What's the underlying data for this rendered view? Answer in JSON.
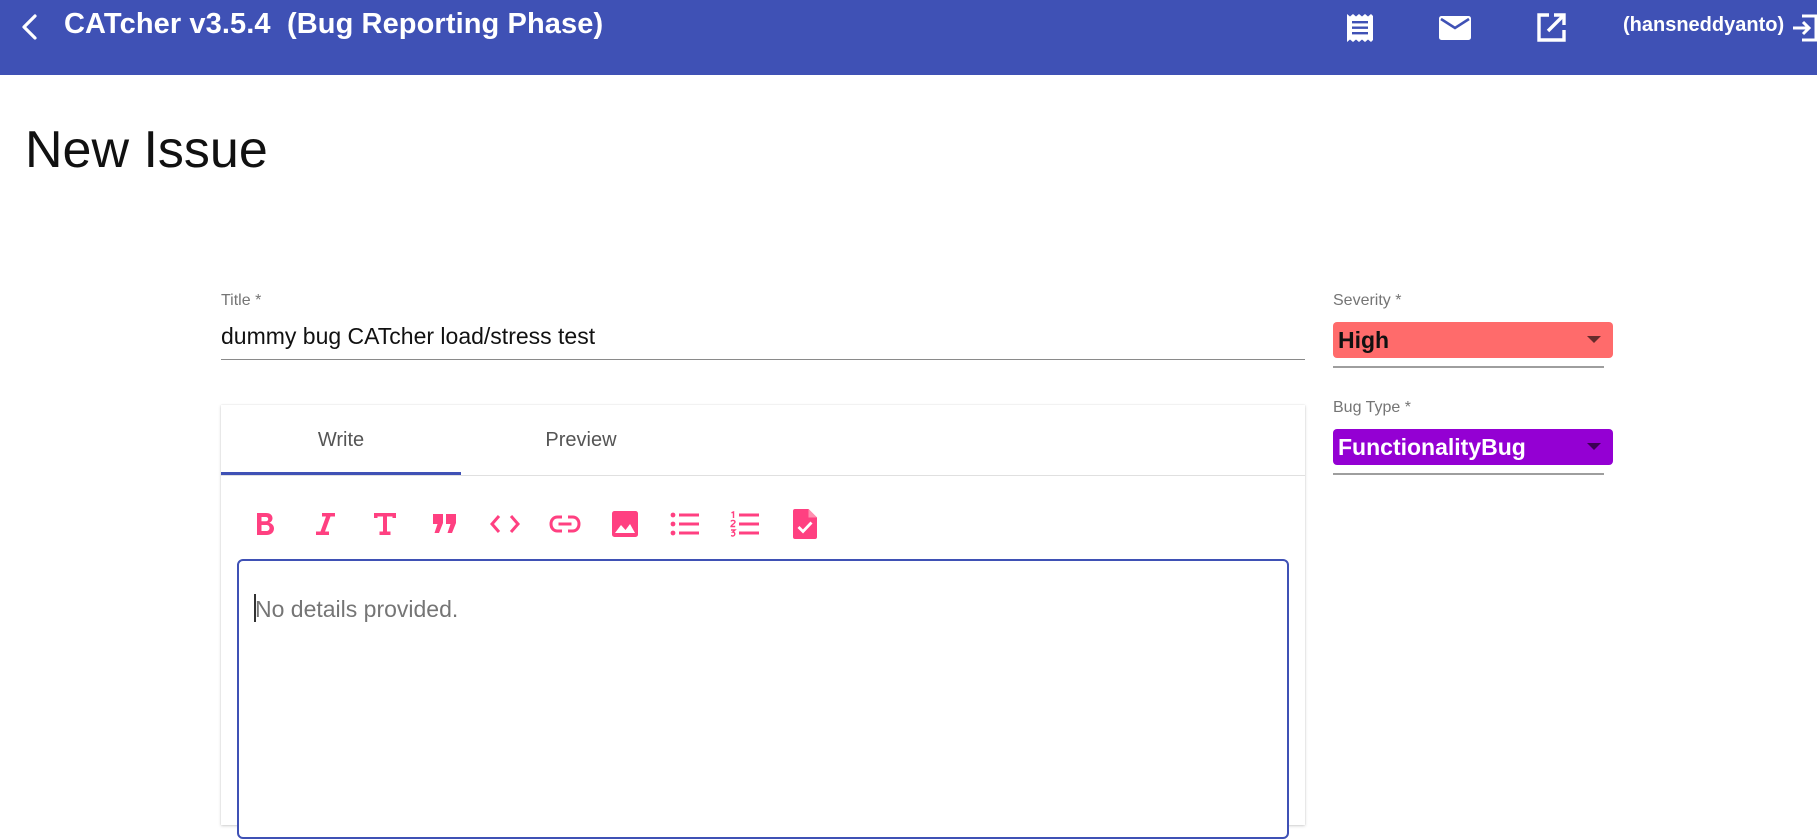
{
  "toolbar": {
    "app_title": "CATcher v3.5.4  (Bug Reporting Phase)",
    "user": "(hansneddyanto)",
    "icons": [
      "back-arrow-icon",
      "receipt-icon",
      "mail-icon",
      "open-in-new-icon",
      "logout-icon"
    ],
    "background_color": "#3f51b5"
  },
  "page": {
    "title": "New Issue"
  },
  "form": {
    "title_label": "Title *",
    "title_value": "dummy bug CATcher load/stress test",
    "severity_label": "Severity *",
    "severity_value": "High",
    "severity_color": "#ff6b6b",
    "bug_type_label": "Bug Type *",
    "bug_type_value": "FunctionalityBug",
    "bug_type_color": "#9400d3"
  },
  "editor": {
    "tabs": [
      {
        "label": "Write",
        "active": true
      },
      {
        "label": "Preview",
        "active": false
      }
    ],
    "toolbar_buttons": [
      "bold-icon",
      "italic-icon",
      "heading-icon",
      "quote-icon",
      "code-icon",
      "link-icon",
      "image-icon",
      "bulleted-list-icon",
      "numbered-list-icon",
      "task-list-icon"
    ],
    "placeholder": "No details provided.",
    "accent_color": "#ff4081"
  }
}
